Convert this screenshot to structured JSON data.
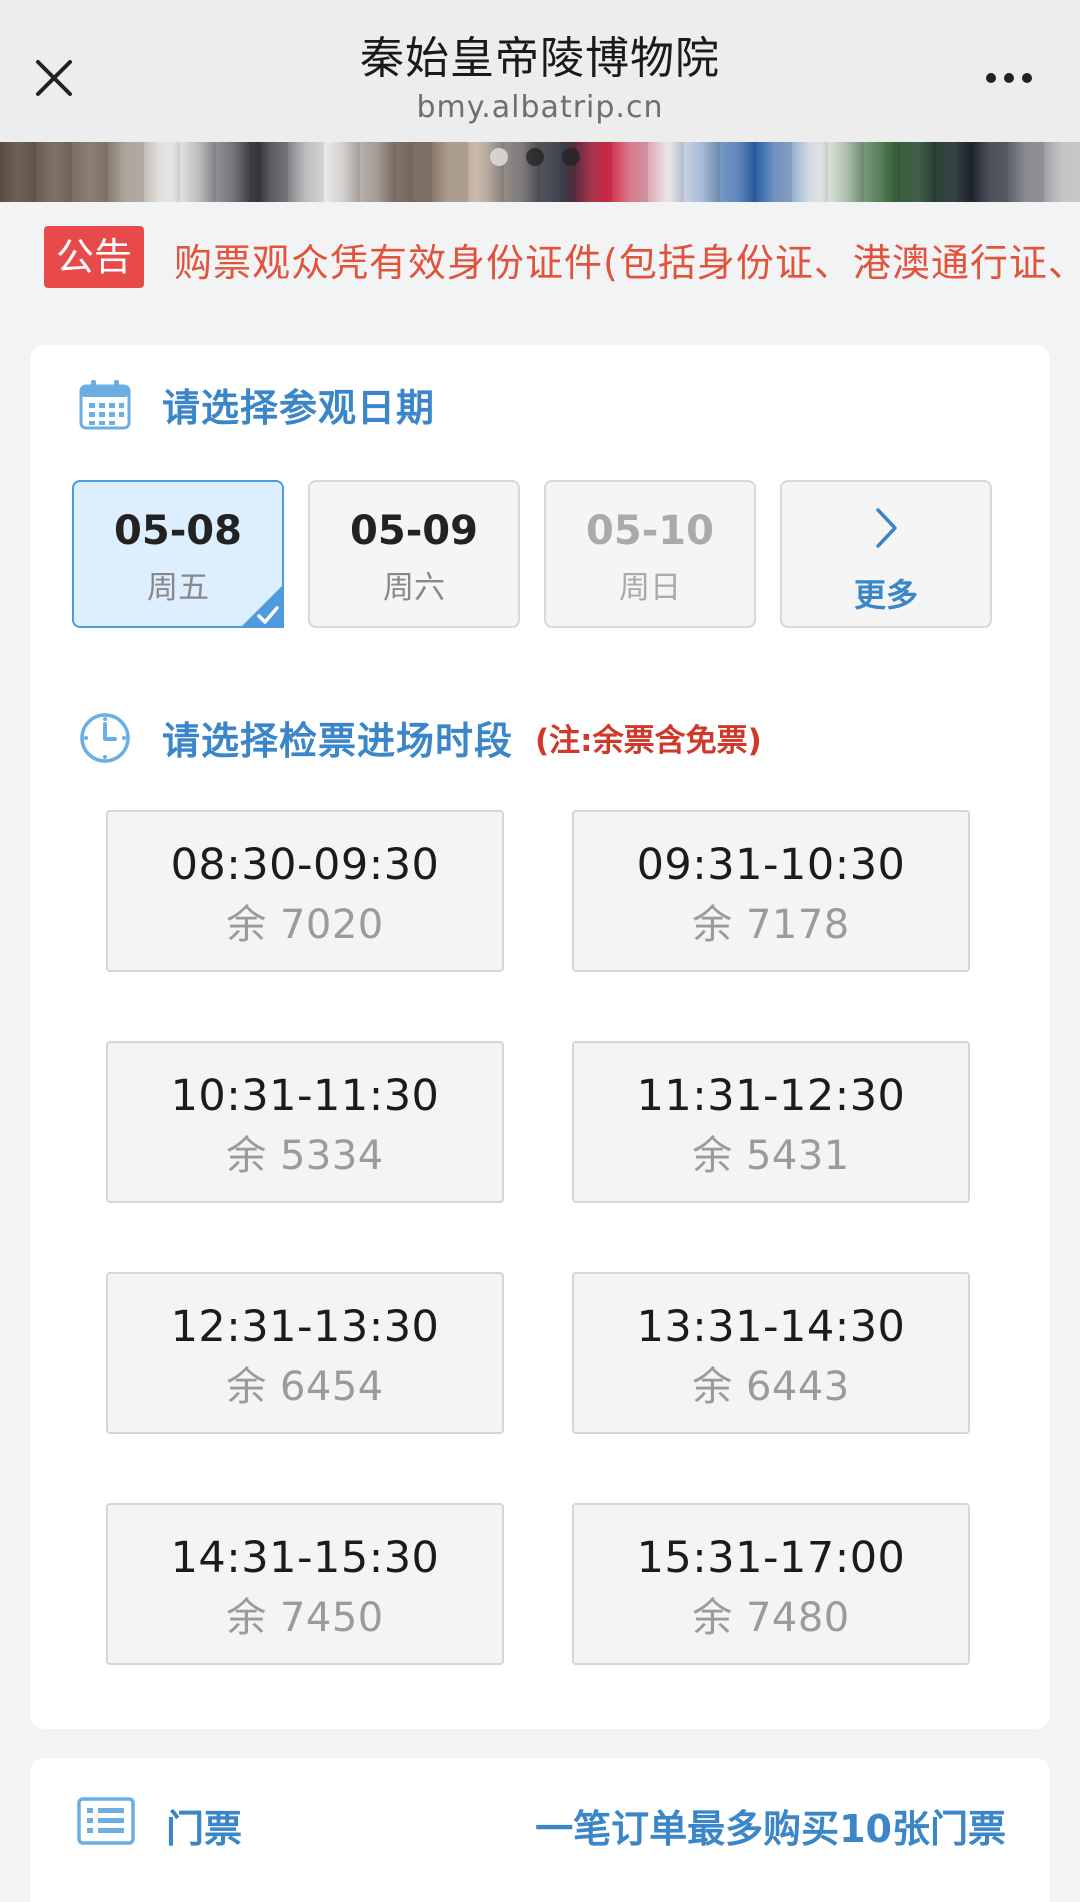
{
  "nav": {
    "title": "秦始皇帝陵博物院",
    "url": "bmy.albatrip.cn",
    "close_icon": "close-icon",
    "more_icon": "more-dots-icon"
  },
  "notice": {
    "badge": "公告",
    "text": "购票观众凭有效身份证件(包括身份证、港澳通行证、"
  },
  "date_section": {
    "title": "请选择参观日期",
    "icon": "calendar-icon",
    "dates": [
      {
        "date": "05-08",
        "weekday": "周五",
        "state": "selected"
      },
      {
        "date": "05-09",
        "weekday": "周六",
        "state": "available"
      },
      {
        "date": "05-10",
        "weekday": "周日",
        "state": "disabled"
      }
    ],
    "more_label": "更多"
  },
  "slot_section": {
    "title": "请选择检票进场时段",
    "note": "(注:余票含免票)",
    "icon": "clock-icon",
    "slots": [
      {
        "time": "08:30-09:30",
        "remaining": "余 7020"
      },
      {
        "time": "09:31-10:30",
        "remaining": "余 7178"
      },
      {
        "time": "10:31-11:30",
        "remaining": "余 5334"
      },
      {
        "time": "11:31-12:30",
        "remaining": "余 5431"
      },
      {
        "time": "12:31-13:30",
        "remaining": "余 6454"
      },
      {
        "time": "13:31-14:30",
        "remaining": "余 6443"
      },
      {
        "time": "14:31-15:30",
        "remaining": "余 7450"
      },
      {
        "time": "15:31-17:00",
        "remaining": "余 7480"
      }
    ]
  },
  "tickets": {
    "label": "门票",
    "limit": "一笔订单最多购买10张门票",
    "icon": "list-icon"
  },
  "colors": {
    "accent": "#3a86c8",
    "notice_red": "#e84a4a",
    "note_red": "#d0382b",
    "selected_bg": "#ddeeff"
  }
}
